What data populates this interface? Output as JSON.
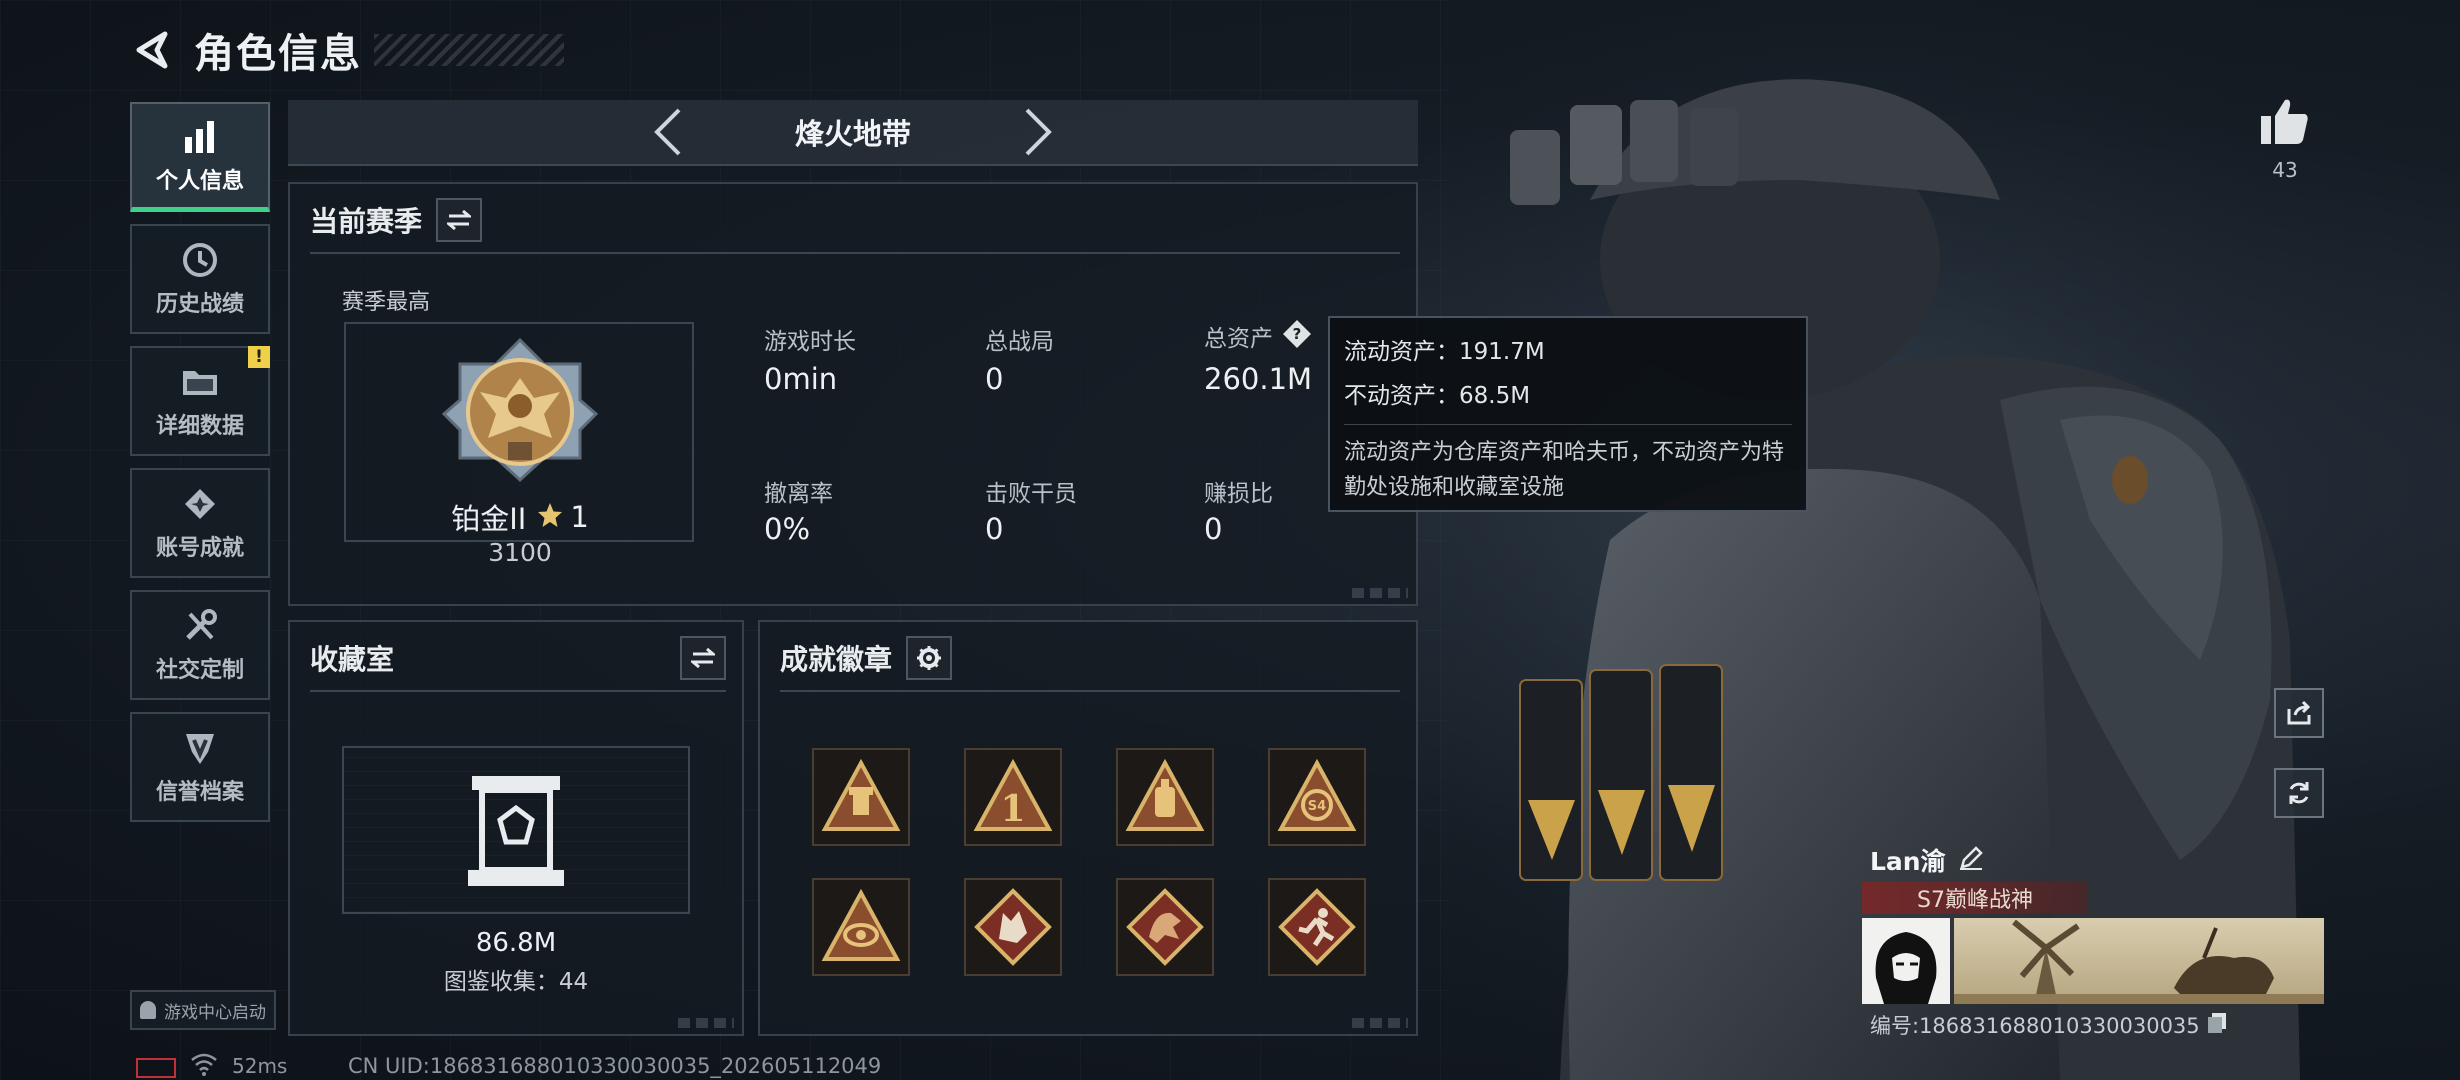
{
  "header": {
    "title": "角色信息"
  },
  "sidebar": {
    "items": [
      {
        "label": "个人信息",
        "icon": "bar-chart-icon",
        "active": true
      },
      {
        "label": "历史战绩",
        "icon": "history-clock-icon"
      },
      {
        "label": "详细数据",
        "icon": "folder-icon",
        "badge": "!"
      },
      {
        "label": "账号成就",
        "icon": "achievement-icon"
      },
      {
        "label": "社交定制",
        "icon": "tools-icon"
      },
      {
        "label": "信誉档案",
        "icon": "reputation-shield-icon"
      }
    ],
    "game_center_launch": "游戏中心启动"
  },
  "mode_selector": {
    "title": "烽火地带"
  },
  "season_panel": {
    "title": "当前赛季",
    "subtitle": "赛季最高",
    "rank_name": "铂金II",
    "rank_stars": "1",
    "rank_score": "3100",
    "stats": [
      {
        "label": "游戏时长",
        "value": "0min"
      },
      {
        "label": "总战局",
        "value": "0"
      },
      {
        "label": "总资产",
        "value": "260.1M"
      },
      {
        "label": "撤离率",
        "value": "0%"
      },
      {
        "label": "击败干员",
        "value": "0"
      },
      {
        "label": "赚损比",
        "value": "0"
      }
    ]
  },
  "tooltip": {
    "liquid": "流动资产：191.7M",
    "fixed": "不动资产：68.5M",
    "description": "流动资产为仓库资产和哈夫币，不动资产为特勤处设施和收藏室设施"
  },
  "collection_panel": {
    "title": "收藏室",
    "value": "86.8M",
    "catalog": "图鉴收集：44"
  },
  "badges_panel": {
    "title": "成就徽章",
    "badges": [
      "badge-trophy",
      "badge-first",
      "badge-lantern",
      "badge-s4",
      "badge-eye",
      "badge-wolf",
      "badge-dragon",
      "badge-runner"
    ]
  },
  "profile": {
    "likes": "43",
    "player_name": "Lan渝",
    "title_tag": "S7巅峰战神",
    "player_id": "编号:1868316880103300300​35"
  },
  "status_bar": {
    "ping": "52ms",
    "uid": "CN UID:186831688010330030035_202605112049"
  },
  "colors": {
    "accent": "#3fd08a",
    "alert": "#f0d04a",
    "tag": "#7a2828"
  }
}
